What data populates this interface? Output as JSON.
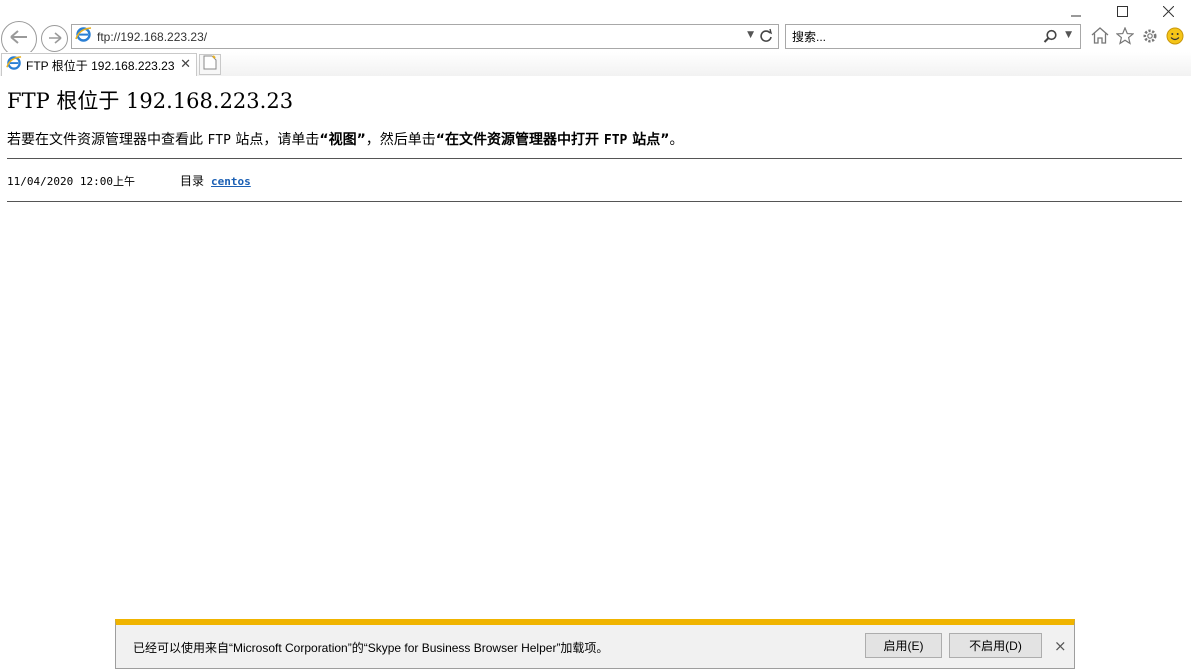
{
  "browser": {
    "address_url": "ftp://192.168.223.23/",
    "search_placeholder": "搜索...",
    "tab_title": "FTP 根位于 192.168.223.23",
    "accent_color": "#f0b400",
    "icons": [
      "back-arrow-icon",
      "forward-arrow-icon",
      "ie-logo-icon",
      "dropdown-arrow-icon",
      "refresh-icon",
      "search-icon",
      "home-icon",
      "favorites-star-icon",
      "gear-icon",
      "smiley-icon",
      "new-tab-icon",
      "minimize-icon",
      "maximize-icon",
      "close-icon"
    ]
  },
  "page": {
    "heading": "FTP 根位于 192.168.223.23",
    "instructions": {
      "part1": "若要在文件资源管理器中查看此",
      "ftp": "FTP",
      "part2": "站点，请单击",
      "quote1": "“视图”",
      "part3": "，然后单击",
      "quote2_a": "“在文件资源管理器中打开",
      "quote2_ftp": "FTP",
      "quote2_b": "站点”",
      "part4": "。"
    },
    "listing": [
      {
        "date": "11/04/2020 12:00上午",
        "type": "目录",
        "name": "centos"
      }
    ]
  },
  "notification": {
    "text": "已经可以使用来自“Microsoft Corporation”的“Skype for Business Browser Helper”加载项。",
    "enable_label": "启用(E)",
    "disable_label": "不启用(D)",
    "close_label": "×"
  }
}
